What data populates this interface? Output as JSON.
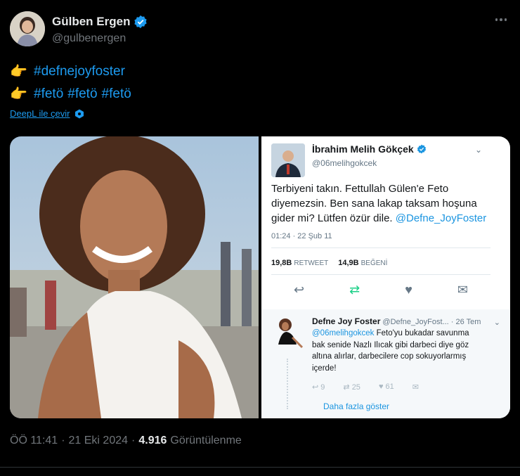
{
  "author": {
    "name": "Gülben Ergen",
    "handle": "@gulbenergen",
    "avatar_icon": "profile-photo-icon",
    "verified_color": "#1d9bf0"
  },
  "tweet": {
    "lines": [
      {
        "emoji": "👉",
        "tags": [
          "#defnejoyfoster"
        ]
      },
      {
        "emoji": "👉",
        "tags": [
          "#fetö",
          "#fetö",
          "#fetö"
        ]
      }
    ],
    "translate_label": "DeepL ile çevir"
  },
  "embedded_tweet": {
    "name": "İbrahim Melih Gökçek",
    "handle": "@06melihgokcek",
    "text": "Terbiyeni takın. Fettullah Gülen'e Feto diyemezsin. Ben sana lakap taksam hoşuna gider mi? Lütfen özür dile.",
    "mention": "@Defne_JoyFoster",
    "time": "01:24 · 22 Şub 11",
    "retweet_count": "19,8B",
    "retweet_label": "RETWEET",
    "like_count": "14,9B",
    "like_label": "BEĞENİ"
  },
  "embedded_reply": {
    "name": "Defne Joy Foster",
    "handle_date": "@Defne_JoyFost... · 26 Tem",
    "mention": "@06melihgokcek",
    "text": "Feto'yu bukadar savunma bak senide Nazlı Ilıcak gibi darbeci diye göz altına alırlar, darbecilere cop sokuyorlarmış içerde!",
    "reply_count": "9",
    "retweet_count": "25",
    "like_count": "61",
    "show_more": "Daha fazla göster"
  },
  "footer": {
    "time": "ÖÖ 11:41",
    "separator": "·",
    "date": "21 Eki 2024",
    "views": "4.916",
    "views_label": "Görüntülenme"
  },
  "colors": {
    "accent": "#1d9bf0",
    "background": "#000000",
    "muted": "#71767b"
  }
}
